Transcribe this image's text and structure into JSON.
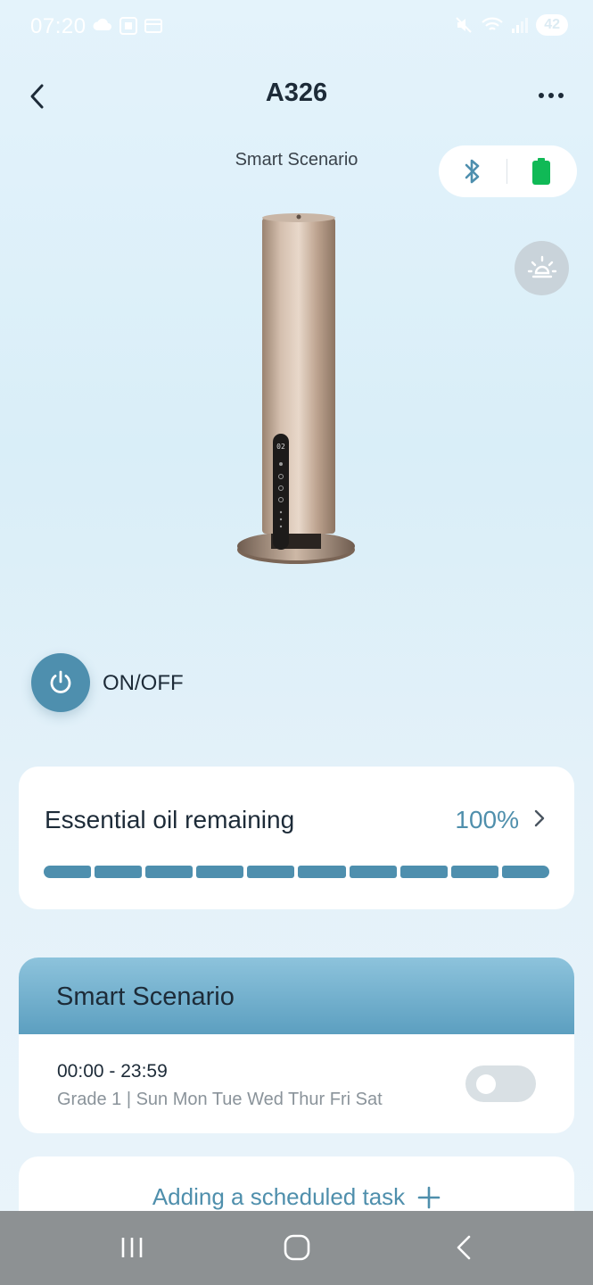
{
  "status_bar": {
    "time": "07:20",
    "battery": "42",
    "icons": [
      "cloud-icon",
      "screenshot-icon",
      "card-icon",
      "mute-icon",
      "wifi-icon",
      "signal-icon"
    ]
  },
  "header": {
    "title": "A326",
    "back_icon": "chevron-left-icon",
    "more_icon": "more-horizontal-icon"
  },
  "scenario_label": "Smart Scenario",
  "connection": {
    "bluetooth_icon": "bluetooth-icon",
    "battery_icon": "battery-full-icon",
    "battery_color": "#10b956"
  },
  "light_icon": "light-bulb-icon",
  "device_display": "02",
  "power": {
    "label": "ON/OFF",
    "color": "#4e8fae"
  },
  "oil": {
    "title": "Essential oil remaining",
    "value": "100%",
    "level_fraction": 1.0,
    "segments": 10,
    "accent": "#4e8fae"
  },
  "smart_scenario": {
    "title": "Smart Scenario",
    "time": "00:00 - 23:59",
    "detail": "Grade 1  |  Sun Mon Tue Wed Thur Fri Sat",
    "enabled": false
  },
  "add_task": {
    "label": "Adding a scheduled task"
  },
  "nav": {
    "buttons": [
      "recents-icon",
      "home-icon",
      "back-icon"
    ]
  }
}
